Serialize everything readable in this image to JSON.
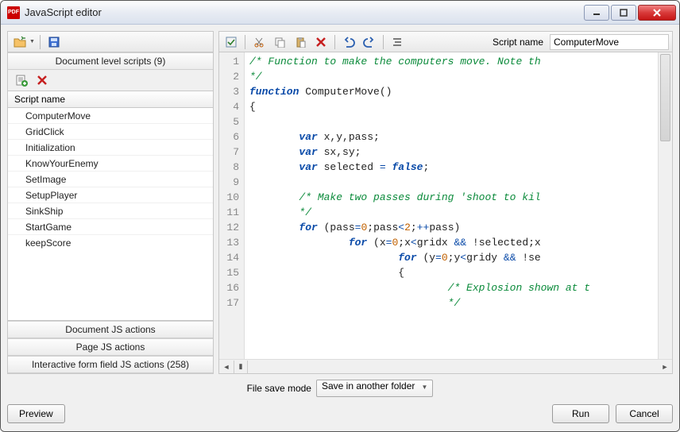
{
  "window": {
    "title": "JavaScript editor"
  },
  "left": {
    "doc_scripts_header": "Document level scripts (9)",
    "list_header": "Script name",
    "scripts": [
      "ComputerMove",
      "GridClick",
      "Initialization",
      "KnowYourEnemy",
      "SetImage",
      "SetupPlayer",
      "SinkShip",
      "StartGame",
      "keepScore"
    ],
    "doc_actions": "Document JS actions",
    "page_actions": "Page JS actions",
    "form_actions": "Interactive form field JS actions (258)"
  },
  "toolbar": {
    "script_name_label": "Script name",
    "script_name_value": "ComputerMove"
  },
  "code": {
    "lines": [
      {
        "n": 1,
        "html": "<span class='cm'>/* Function to make the computers move. Note th</span>"
      },
      {
        "n": 2,
        "html": "<span class='cm'>*/</span>"
      },
      {
        "n": 3,
        "html": "<span class='kw'>function</span> ComputerMove()"
      },
      {
        "n": 4,
        "html": "{"
      },
      {
        "n": 5,
        "html": ""
      },
      {
        "n": 6,
        "html": "        <span class='kw'>var</span> x,y,pass;"
      },
      {
        "n": 7,
        "html": "        <span class='kw'>var</span> sx,sy;"
      },
      {
        "n": 8,
        "html": "        <span class='kw'>var</span> selected <span class='op'>=</span> <span class='kw'>false</span>;"
      },
      {
        "n": 9,
        "html": ""
      },
      {
        "n": 10,
        "html": "        <span class='cm'>/* Make two passes during 'shoot to kil</span>"
      },
      {
        "n": 11,
        "html": "        <span class='cm'>*/</span>"
      },
      {
        "n": 12,
        "html": "        <span class='kw'>for</span> (pass<span class='op'>=</span><span class='num'>0</span>;pass<span class='op'>&lt;</span><span class='num'>2</span>;<span class='op'>++</span>pass)"
      },
      {
        "n": 13,
        "html": "                <span class='kw'>for</span> (x<span class='op'>=</span><span class='num'>0</span>;x<span class='op'>&lt;</span>gridx <span class='op'>&amp;&amp;</span> !selected;x"
      },
      {
        "n": 14,
        "html": "                        <span class='kw'>for</span> (y<span class='op'>=</span><span class='num'>0</span>;y<span class='op'>&lt;</span>gridy <span class='op'>&amp;&amp;</span> !se"
      },
      {
        "n": 15,
        "html": "                        {"
      },
      {
        "n": 16,
        "html": "                                <span class='cm'>/* Explosion shown at t</span>"
      },
      {
        "n": 17,
        "html": "                                <span class='cm'>*/</span>"
      }
    ]
  },
  "save": {
    "label": "File save mode",
    "selected": "Save in another folder"
  },
  "buttons": {
    "preview": "Preview",
    "run": "Run",
    "cancel": "Cancel"
  }
}
